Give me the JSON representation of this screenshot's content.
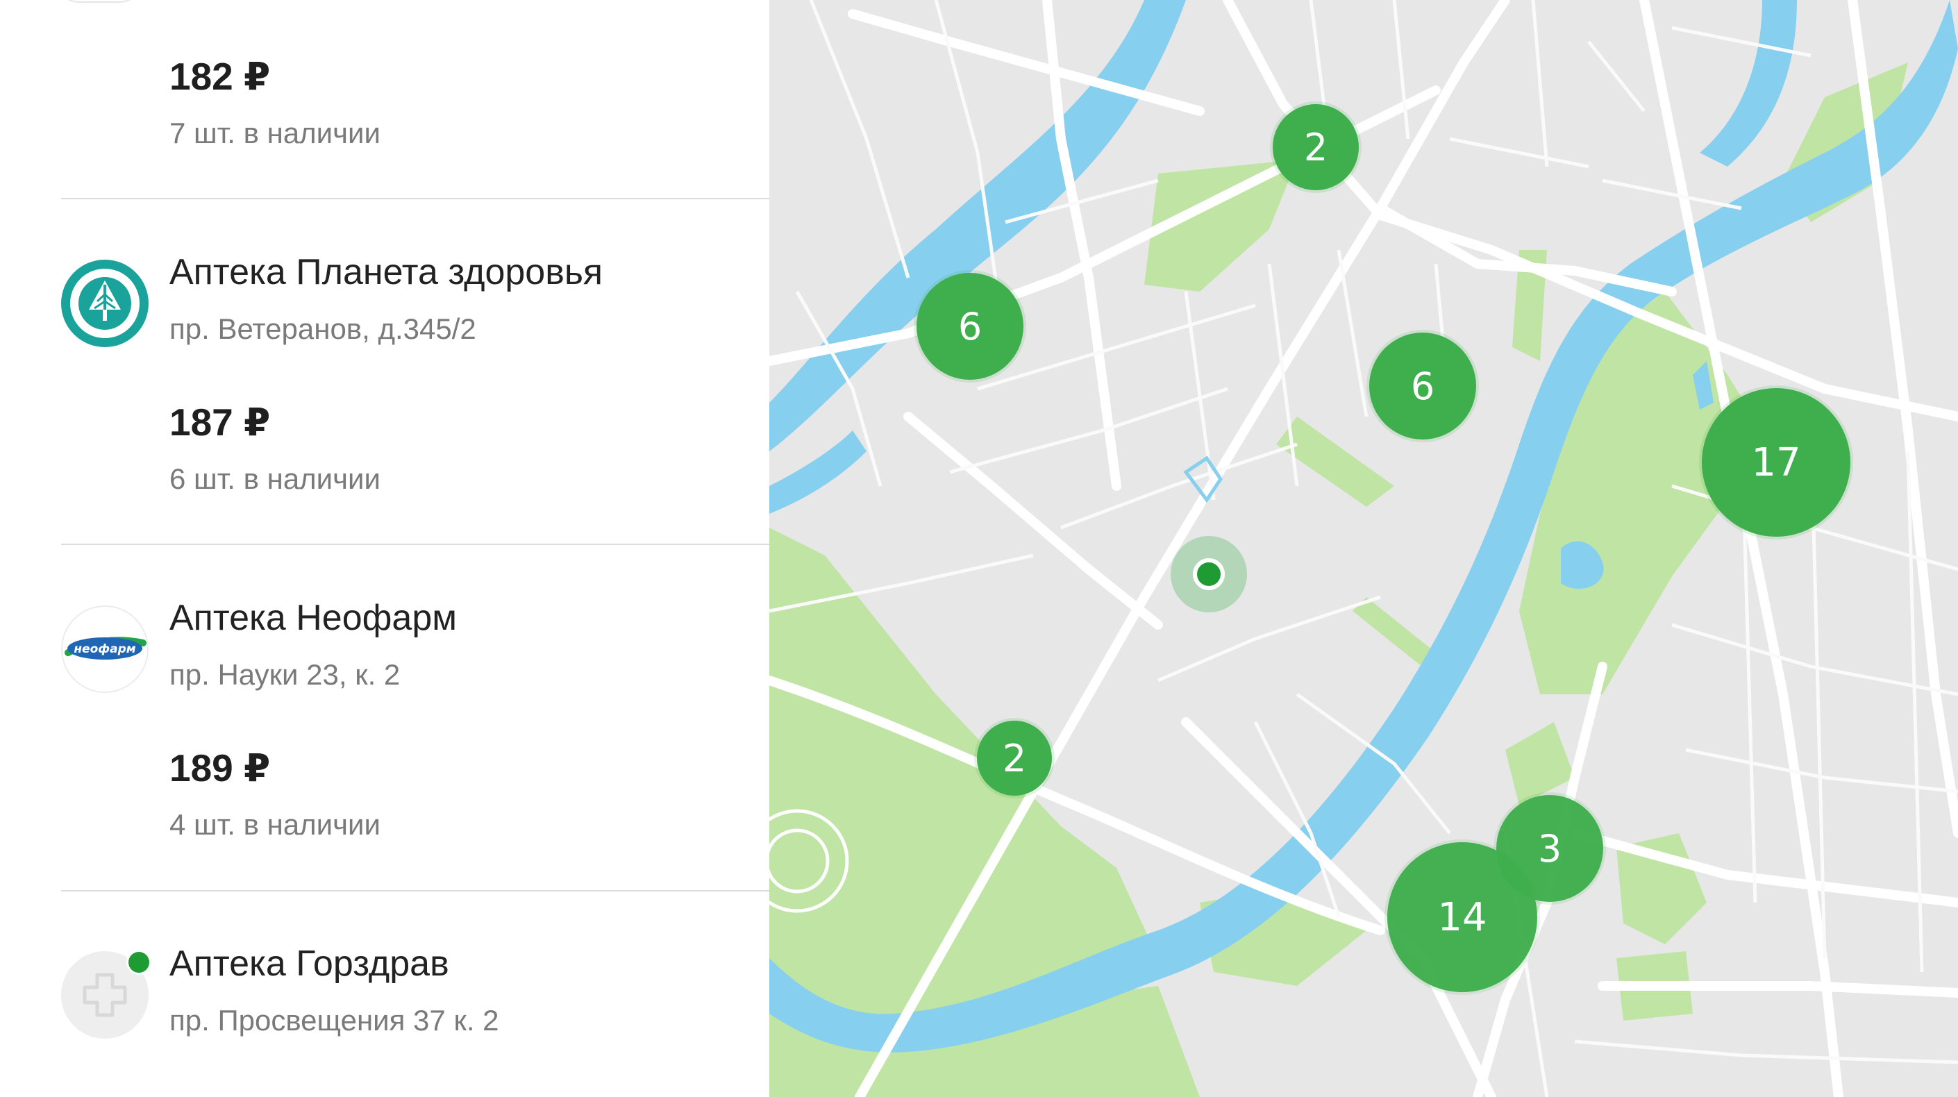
{
  "offers": [
    {
      "pharmacy": null,
      "price": "182 ₽",
      "stock": "7 шт. в наличии"
    },
    {
      "pharmacy": {
        "name": "Аптека Планета здоровья",
        "address": "пр. Ветеранов, д.345/2",
        "logo": "planeta-zdorovya-logo"
      },
      "price": "187 ₽",
      "stock": "6 шт. в наличии"
    },
    {
      "pharmacy": {
        "name": "Аптека Неофарм",
        "address": "пр. Науки 23, к. 2",
        "logo": "neofarm-logo",
        "logo_text": "неофарм"
      },
      "price": "189 ₽",
      "stock": "4 шт. в наличии"
    },
    {
      "pharmacy": {
        "name": "Аптека Горздрав",
        "address": "пр. Просвещения 37 к. 2",
        "logo": "gorzdrav-logo",
        "online": true
      },
      "price": null,
      "stock": null
    }
  ],
  "map": {
    "clusters": [
      {
        "count": "2"
      },
      {
        "count": "6"
      },
      {
        "count": "6"
      },
      {
        "count": "17"
      },
      {
        "count": "2"
      },
      {
        "count": "3"
      },
      {
        "count": "14"
      }
    ],
    "colors": {
      "water": "#86cfee",
      "park": "#bfe4a3",
      "land": "#e7e7e7",
      "road": "#ffffff",
      "cluster": "#3fae4c",
      "user_location": "#1e9b33"
    }
  }
}
